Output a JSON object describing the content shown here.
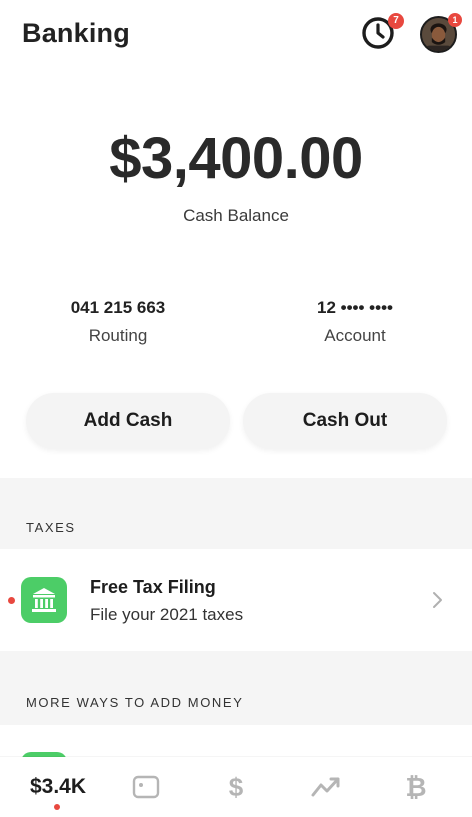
{
  "header": {
    "title": "Banking",
    "activity_icon": "clock-icon",
    "activity_badge": "7",
    "profile_badge": "1"
  },
  "balance": {
    "amount": "$3,400.00",
    "label": "Cash Balance"
  },
  "account_info": {
    "routing_number": "041 215 663",
    "routing_label": "Routing",
    "account_number": "12 •••• ••••",
    "account_label": "Account"
  },
  "actions": {
    "add_cash": "Add Cash",
    "cash_out": "Cash Out"
  },
  "sections": {
    "taxes_header": "TAXES",
    "more_header": "MORE WAYS TO ADD MONEY"
  },
  "tax_item": {
    "title": "Free Tax Filing",
    "subtitle": "File your 2021 taxes",
    "icon": "bank-building-icon"
  },
  "tabbar": {
    "balance_label": "$3.4K",
    "card_icon": "card-icon",
    "pay_glyph": "$",
    "invest_icon": "chart-trend-icon",
    "bitcoin_glyph": "₿"
  },
  "colors": {
    "accent_green": "#4ccd67",
    "badge_red": "#e8483f",
    "inactive_gray": "#b5b5b5"
  }
}
